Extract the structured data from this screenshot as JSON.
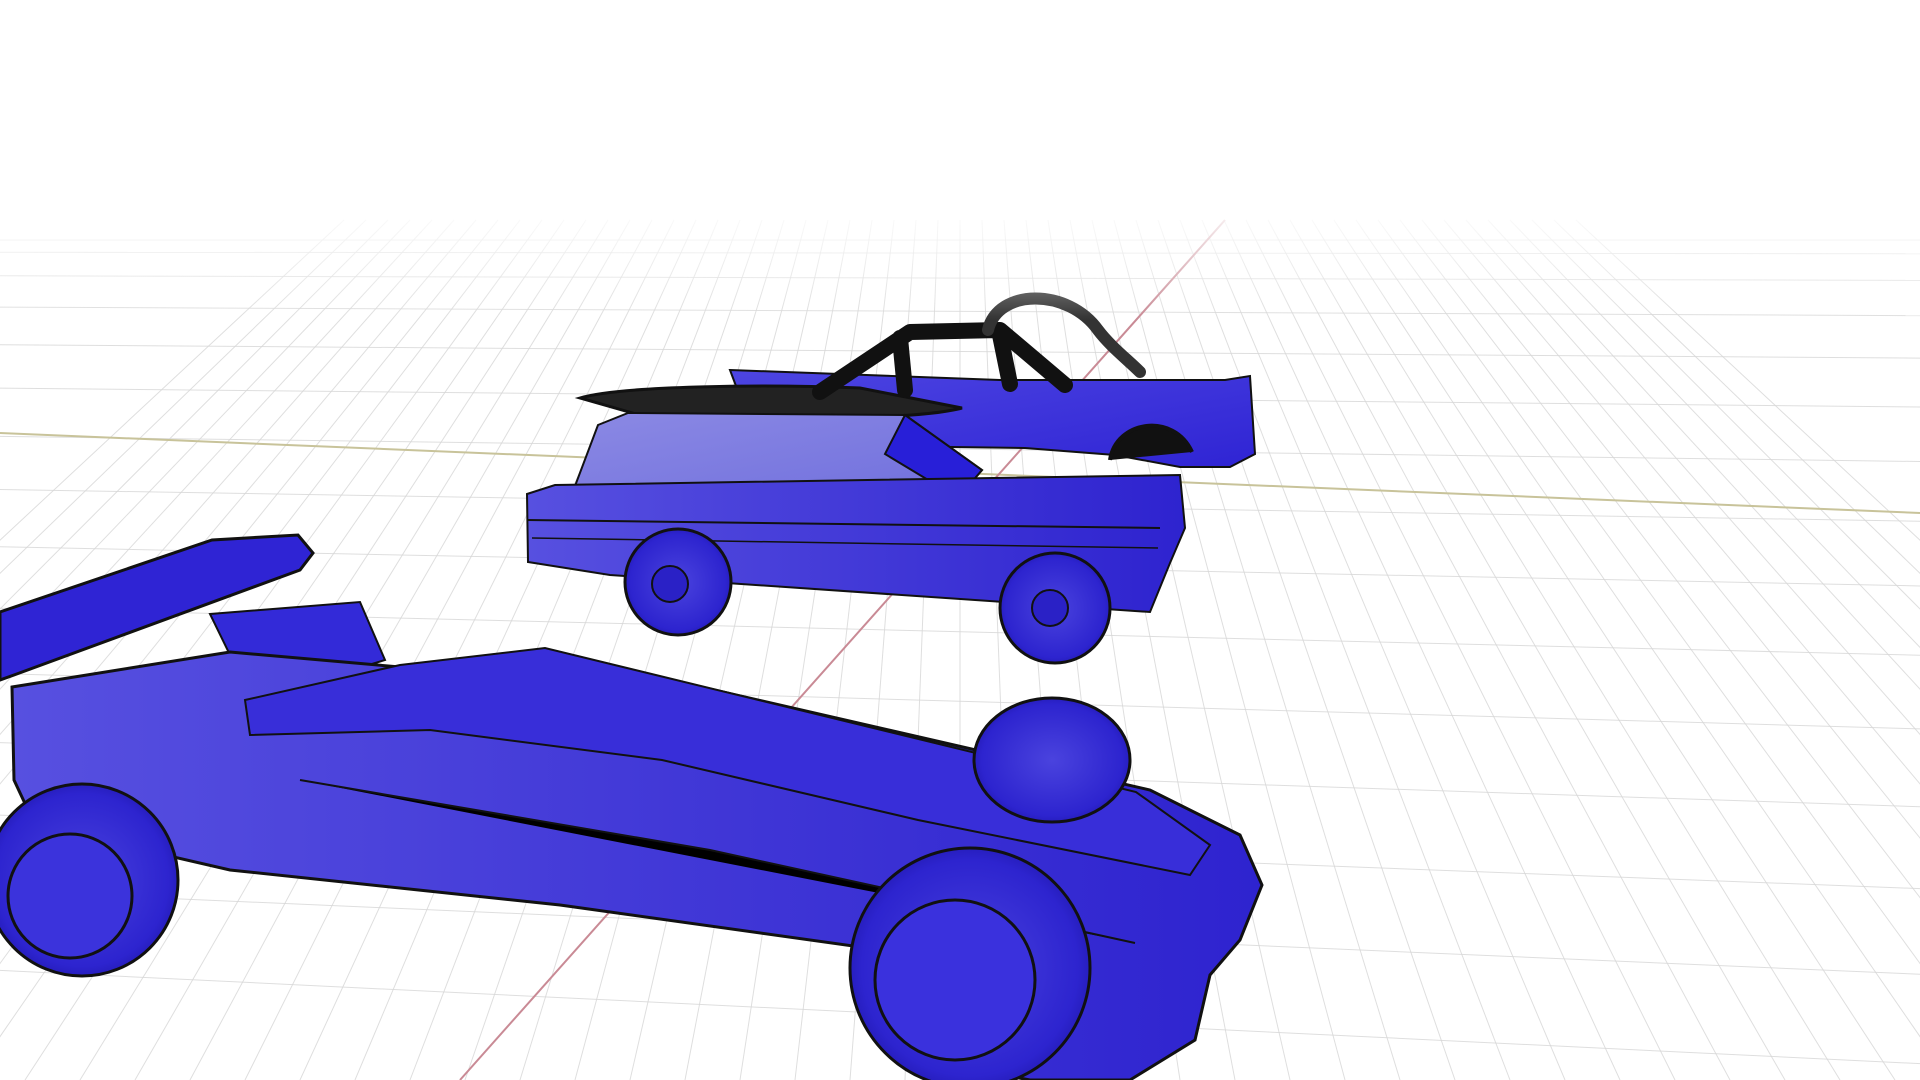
{
  "viewport": {
    "background": "#ffffff",
    "grid_color": "#d7d7d7",
    "x_axis_color": "#c8c39a",
    "y_axis_color": "#c98a95"
  },
  "models": [
    {
      "id": "rear-car",
      "label": "",
      "body_color": "#3f35d8",
      "cage_color": "#111111"
    },
    {
      "id": "middle-car",
      "label": "",
      "body_color": "#3f35d8",
      "window_color": "#7f7fe0"
    },
    {
      "id": "front-car",
      "label": "",
      "body_color": "#3f35d8",
      "wing_color": "#2f24d4",
      "tire_color": "#3028c9"
    }
  ]
}
